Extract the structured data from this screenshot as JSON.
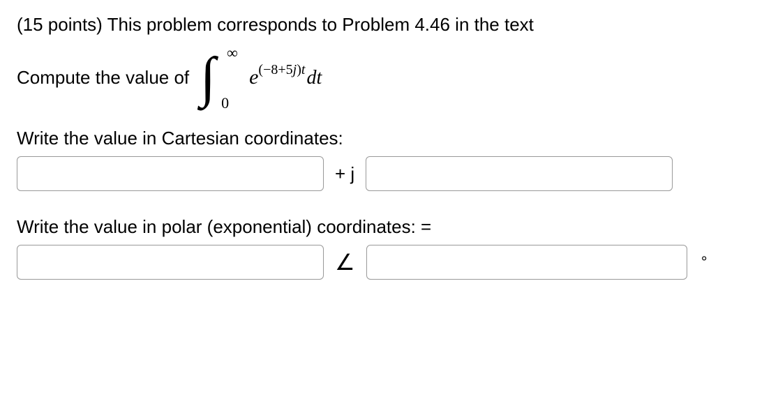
{
  "problem": {
    "intro": "(15 points) This problem corresponds to Problem 4.46 in the text",
    "compute_prefix": "Compute the value of",
    "integral": {
      "symbol": "∫",
      "upper": "∞",
      "lower": "0",
      "integrand_base": "e",
      "exponent_open": "(",
      "exponent_minus": "−",
      "exponent_a": "8",
      "exponent_plus": "+",
      "exponent_b": "5",
      "exponent_j": "j",
      "exponent_close": ")",
      "exponent_t": "t",
      "dt": "dt"
    },
    "cartesian_label": "Write the value in Cartesian coordinates:",
    "cartesian_sep": "+ j",
    "polar_label": "Write the value in polar (exponential) coordinates: =",
    "angle_sep": "∠",
    "degree": "°"
  },
  "inputs": {
    "cartesian_real": "",
    "cartesian_imag": "",
    "polar_mag": "",
    "polar_angle": ""
  }
}
